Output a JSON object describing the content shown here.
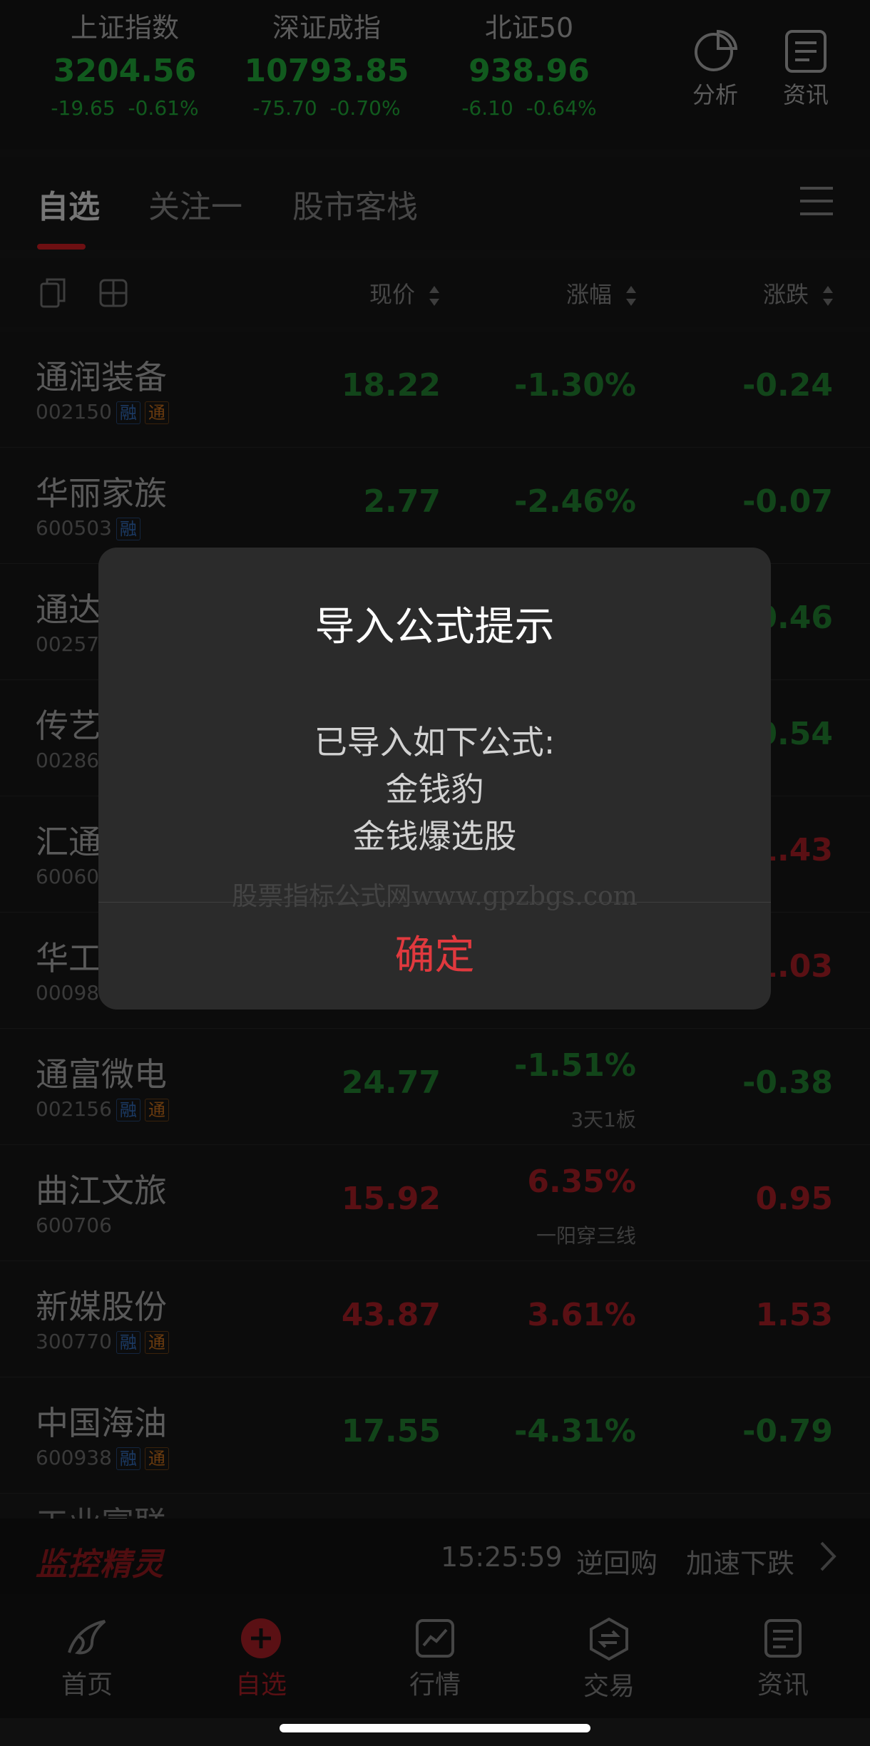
{
  "indices": [
    {
      "name": "上证指数",
      "value": "3204.56",
      "change": "-19.65",
      "percent": "-0.61%"
    },
    {
      "name": "深证成指",
      "value": "10793.85",
      "change": "-75.70",
      "percent": "-0.70%"
    },
    {
      "name": "北证50",
      "value": "938.96",
      "change": "-6.10",
      "percent": "-0.64%"
    }
  ],
  "header_tools": {
    "analysis": "分析",
    "news": "资讯"
  },
  "tabs": [
    "自选",
    "关注一",
    "股市客栈"
  ],
  "columns": {
    "price": "现价",
    "percent": "涨幅",
    "change": "涨跌"
  },
  "stocks": [
    {
      "name": "通润装备",
      "code": "002150",
      "rong": true,
      "tong": true,
      "price": "18.22",
      "percent": "-1.30%",
      "change": "-0.24",
      "dir": "down",
      "note": ""
    },
    {
      "name": "华丽家族",
      "code": "600503",
      "rong": true,
      "tong": false,
      "price": "2.77",
      "percent": "-2.46%",
      "change": "-0.07",
      "dir": "down",
      "note": ""
    },
    {
      "name": "通达",
      "code": "00257",
      "rong": false,
      "tong": false,
      "price": "",
      "percent": "",
      "change": "0.46",
      "dir": "down",
      "note": ""
    },
    {
      "name": "传艺",
      "code": "00286",
      "rong": false,
      "tong": false,
      "price": "",
      "percent": "",
      "change": "0.54",
      "dir": "down",
      "note": ""
    },
    {
      "name": "汇通",
      "code": "60060",
      "rong": false,
      "tong": false,
      "price": "",
      "percent": "",
      "change": "1.43",
      "dir": "up",
      "note": ""
    },
    {
      "name": "华工",
      "code": "00098",
      "rong": false,
      "tong": false,
      "price": "",
      "percent": "",
      "change": "1.03",
      "dir": "up",
      "note": ""
    },
    {
      "name": "通富微电",
      "code": "002156",
      "rong": true,
      "tong": true,
      "price": "24.77",
      "percent": "-1.51%",
      "change": "-0.38",
      "dir": "down",
      "note": "3天1板"
    },
    {
      "name": "曲江文旅",
      "code": "600706",
      "rong": false,
      "tong": false,
      "price": "15.92",
      "percent": "6.35%",
      "change": "0.95",
      "dir": "up",
      "note": "一阳穿三线"
    },
    {
      "name": "新媒股份",
      "code": "300770",
      "rong": true,
      "tong": true,
      "price": "43.87",
      "percent": "3.61%",
      "change": "1.53",
      "dir": "up",
      "note": ""
    },
    {
      "name": "中国海油",
      "code": "600938",
      "rong": true,
      "tong": true,
      "price": "17.55",
      "percent": "-4.31%",
      "change": "-0.79",
      "dir": "down",
      "note": ""
    }
  ],
  "tags": {
    "rong": "融",
    "tong": "通"
  },
  "monitor": {
    "brand": "监控精灵",
    "time": "15:25:59",
    "event1": "逆回购",
    "event2": "加速下跌"
  },
  "bottom_nav": [
    "首页",
    "自选",
    "行情",
    "交易",
    "资讯"
  ],
  "dialog": {
    "title": "导入公式提示",
    "lines": [
      "已导入如下公式:",
      "金钱豹",
      "金钱爆选股"
    ],
    "watermark": "股票指标公式网www.gpzbgs.com",
    "confirm": "确定"
  },
  "colors": {
    "up": "#8a1a1f",
    "down": "#1d6b28",
    "confirm": "#e0393e",
    "accent": "#a8171d"
  }
}
